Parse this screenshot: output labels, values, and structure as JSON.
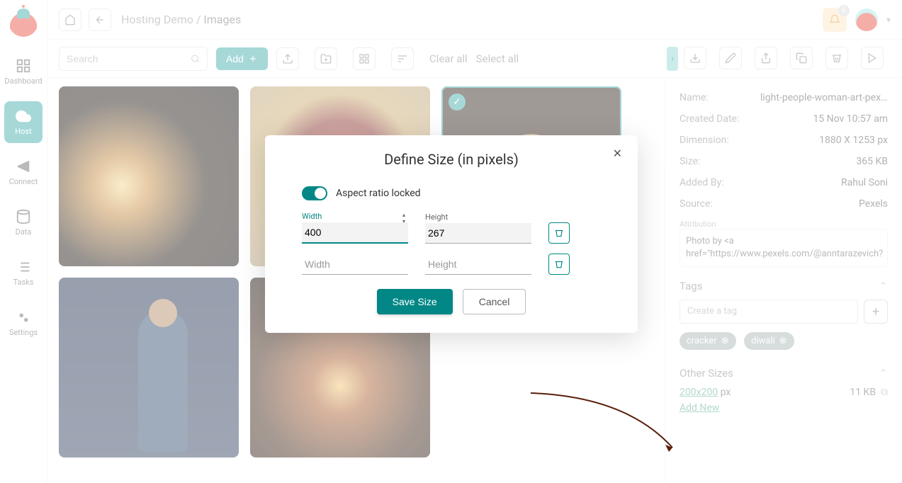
{
  "sidebar": {
    "items": [
      {
        "label": "Dashboard"
      },
      {
        "label": "Host"
      },
      {
        "label": "Connect"
      },
      {
        "label": "Data"
      },
      {
        "label": "Tasks"
      },
      {
        "label": "Settings"
      }
    ]
  },
  "breadcrumb": {
    "parent": "Hosting Demo",
    "sep": "/",
    "current": "Images"
  },
  "notifications": {
    "count": "6"
  },
  "toolbar": {
    "search_placeholder": "Search",
    "add_label": "Add",
    "clear_all": "Clear all",
    "select_all": "Select all"
  },
  "details": {
    "name_label": "Name:",
    "name_value": "light-people-woman-art-pex...",
    "created_label": "Created Date:",
    "created_value": "15 Nov 10:57 am",
    "dimension_label": "Dimension:",
    "dimension_value": "1880 X 1253 px",
    "size_label": "Size:",
    "size_value": "365 KB",
    "addedby_label": "Added By:",
    "addedby_value": "Rahul Soni",
    "source_label": "Source:",
    "source_value": "Pexels",
    "attribution_label": "Attribution",
    "attribution_text": "Photo by <a href=\"https://www.pexels.com/@anntarazevich?",
    "tags_heading": "Tags",
    "tag_placeholder": "Create a tag",
    "tags": [
      {
        "label": "cracker"
      },
      {
        "label": "diwali"
      }
    ],
    "other_sizes_heading": "Other Sizes",
    "sizes": [
      {
        "dim": "200x200",
        "unit": "px",
        "file_size": "11 KB"
      }
    ],
    "add_new": "Add New"
  },
  "modal": {
    "title": "Define Size (in pixels)",
    "aspect_label": "Aspect ratio locked",
    "width_label": "Width",
    "height_label": "Height",
    "width_value": "400",
    "height_value": "267",
    "width_placeholder": "Width",
    "height_placeholder": "Height",
    "save": "Save Size",
    "cancel": "Cancel"
  }
}
